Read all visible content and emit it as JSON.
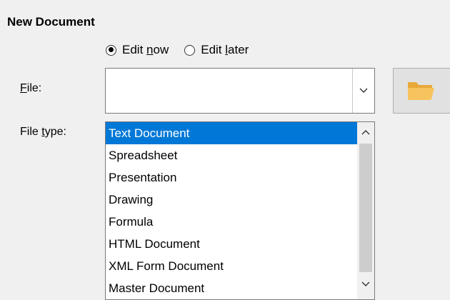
{
  "section": {
    "title": "New Document"
  },
  "edit_mode": {
    "options": [
      {
        "before": "Edit ",
        "mnemonic": "n",
        "after": "ow",
        "checked": true
      },
      {
        "before": "Edit ",
        "mnemonic": "l",
        "after": "ater",
        "checked": false
      }
    ]
  },
  "file": {
    "label_mnemonic": "F",
    "label_rest": "ile:",
    "value": "",
    "dropdown_icon": "chevron-down-icon",
    "browse_icon": "folder-icon"
  },
  "file_type": {
    "label_before": "File ",
    "label_mnemonic": "t",
    "label_after": "ype:",
    "selected": "Text Document",
    "items": [
      "Text Document",
      "Spreadsheet",
      "Presentation",
      "Drawing",
      "Formula",
      "HTML Document",
      "XML Form Document",
      "Master Document"
    ]
  },
  "colors": {
    "selection": "#0078d7",
    "folder": "#f7c35f"
  }
}
